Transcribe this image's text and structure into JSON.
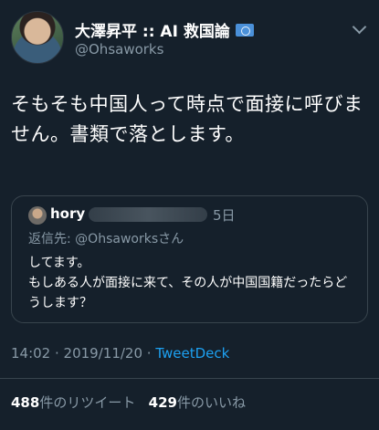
{
  "author": {
    "display_name": "大澤昇平 :: AI 救国論",
    "handle": "@Ohsaworks",
    "badge_icon": "flag-icon"
  },
  "tweet": {
    "text": "そもそも中国人って時点で面接に呼びません。書類で落とします。"
  },
  "quoted_tweet": {
    "name": "hory",
    "time": "5日",
    "reply_to_prefix": "返信先: ",
    "reply_to_handle": "@Ohsaworks",
    "reply_to_suffix": "さん",
    "body": "してます。\nもしある人が面接に来て、その人が中国国籍だったらどうします？"
  },
  "meta": {
    "time": "14:02",
    "separator1": " · ",
    "date": "2019/11/20",
    "separator2": " · ",
    "source": "TweetDeck"
  },
  "stats": {
    "retweet_count": "488",
    "retweet_label": "件のリツイート",
    "like_count": "429",
    "like_label": "件のいいね"
  },
  "colors": {
    "background": "#15202b",
    "secondary_text": "#8899a6",
    "link": "#1da1f2"
  }
}
